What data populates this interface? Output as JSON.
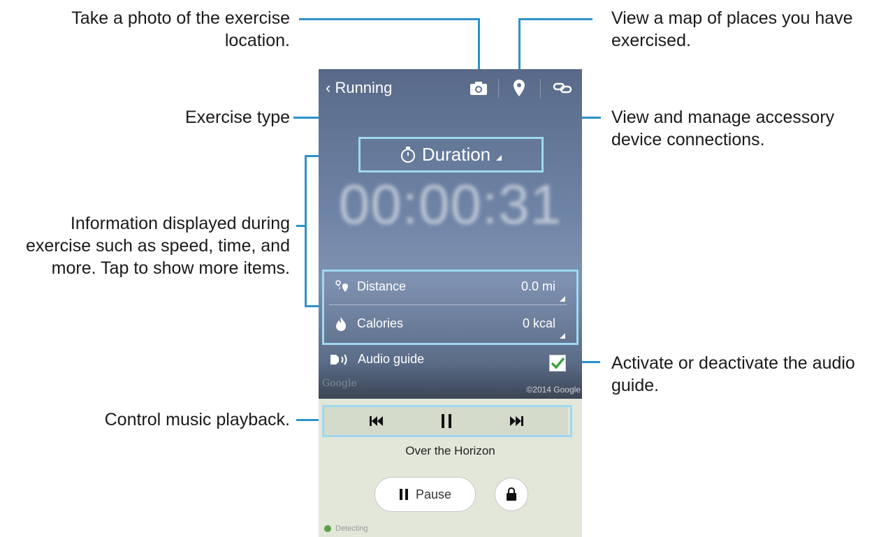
{
  "callouts": {
    "photo": [
      "Take a photo of the exercise",
      "location."
    ],
    "map": [
      "View a map of places you have",
      "exercised."
    ],
    "type": "Exercise type",
    "accessory": [
      "View and manage accessory",
      "device connections."
    ],
    "info": [
      "Information displayed during",
      "exercise such as speed, time, and",
      "more. Tap to show more items."
    ],
    "audio": [
      "Activate or deactivate the audio",
      "guide."
    ],
    "music": "Control music playback."
  },
  "phone": {
    "back_label": "Running",
    "duration_label": "Duration",
    "timer": "00:00:31",
    "rows": [
      {
        "label": "Distance",
        "value": "0.0 mi",
        "icon": "route-pin-icon"
      },
      {
        "label": "Calories",
        "value": "0 kcal",
        "icon": "flame-icon"
      }
    ],
    "audio_label": "Audio guide",
    "audio_checked": true,
    "google": "Google",
    "copyright": "©2014 Google",
    "song": "Over the Horizon",
    "pause_label": "Pause",
    "detecting": "Detecting"
  },
  "colors": {
    "accent_line": "#2a93c8",
    "highlight": "#9fd8f0",
    "check": "#3fa33f"
  }
}
